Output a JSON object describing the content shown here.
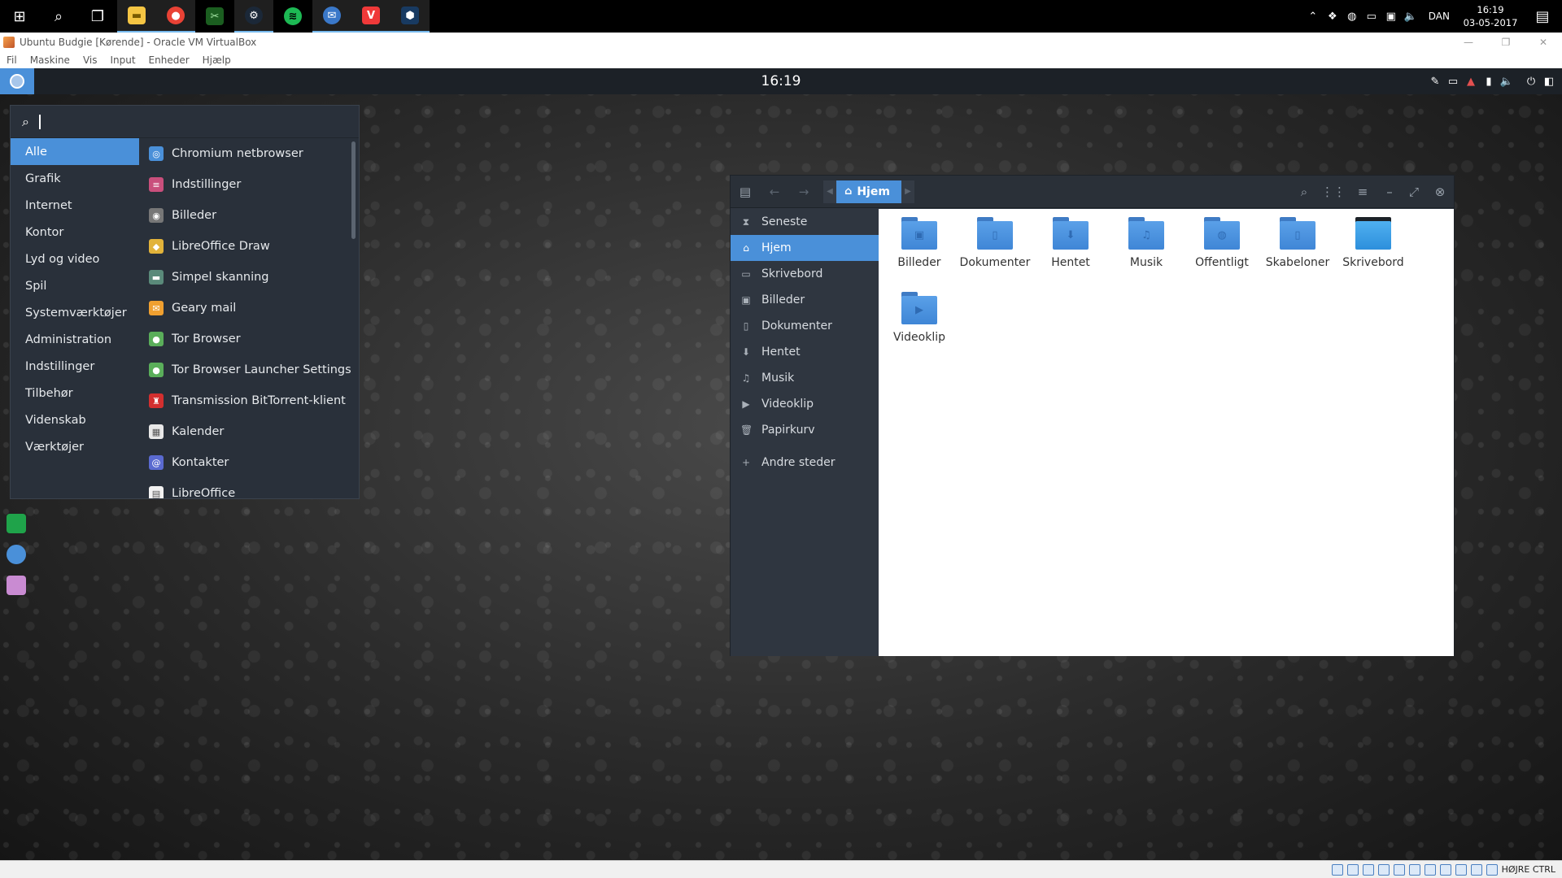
{
  "taskbar": {
    "icons": [
      "windows-start-icon",
      "search-icon",
      "task-view-icon",
      "file-explorer-icon",
      "chrome-icon",
      "app-icon",
      "steam-icon",
      "spotify-icon",
      "thunderbird-icon",
      "vivaldi-icon",
      "virtualbox-icon"
    ],
    "language": "DAN",
    "time": "16:19",
    "date": "03-05-2017"
  },
  "vbox": {
    "title": "Ubuntu Budgie [Kørende] - Oracle VM VirtualBox",
    "menu": [
      "Fil",
      "Maskine",
      "Vis",
      "Input",
      "Enheder",
      "Hjælp"
    ],
    "host_key": "HØJRE CTRL"
  },
  "panel": {
    "clock": "16:19"
  },
  "app_menu": {
    "search_placeholder": "",
    "categories": [
      "Alle",
      "Grafik",
      "Internet",
      "Kontor",
      "Lyd og video",
      "Spil",
      "Systemværktøjer",
      "Administration",
      "Indstillinger",
      "Tilbehør",
      "Videnskab",
      "Værktøjer"
    ],
    "selected_category": "Alle",
    "apps": [
      {
        "label": "Chromium netbrowser",
        "color": "#4a90d9",
        "glyph": "◎"
      },
      {
        "label": "Indstillinger",
        "color": "#c94f7c",
        "glyph": "≡"
      },
      {
        "label": "Billeder",
        "color": "#777777",
        "glyph": "◉"
      },
      {
        "label": "LibreOffice Draw",
        "color": "#e2b33a",
        "glyph": "◆"
      },
      {
        "label": "Simpel skanning",
        "color": "#5a8a7a",
        "glyph": "▬"
      },
      {
        "label": "Geary mail",
        "color": "#f0a030",
        "glyph": "✉"
      },
      {
        "label": "Tor Browser",
        "color": "#5aae5a",
        "glyph": "●"
      },
      {
        "label": "Tor Browser Launcher Settings",
        "color": "#5aae5a",
        "glyph": "●"
      },
      {
        "label": "Transmission BitTorrent-klient",
        "color": "#d32f2f",
        "glyph": "♜"
      },
      {
        "label": "Kalender",
        "color": "#e8e8e8",
        "glyph": "▦"
      },
      {
        "label": "Kontakter",
        "color": "#5a6ad0",
        "glyph": "@"
      },
      {
        "label": "LibreOffice",
        "color": "#f2f2f2",
        "glyph": "▤"
      }
    ]
  },
  "files": {
    "path": "Hjem",
    "sidebar": [
      {
        "label": "Seneste",
        "icon": "⧗"
      },
      {
        "label": "Hjem",
        "icon": "⌂"
      },
      {
        "label": "Skrivebord",
        "icon": "▭"
      },
      {
        "label": "Billeder",
        "icon": "▣"
      },
      {
        "label": "Dokumenter",
        "icon": "▯"
      },
      {
        "label": "Hentet",
        "icon": "⬇"
      },
      {
        "label": "Musik",
        "icon": "♫"
      },
      {
        "label": "Videoklip",
        "icon": "▶"
      },
      {
        "label": "Papirkurv",
        "icon": "🗑"
      },
      {
        "label": "Andre steder",
        "icon": "+"
      }
    ],
    "selected_sidebar": "Hjem",
    "items": [
      {
        "label": "Billeder",
        "glyph": "▣"
      },
      {
        "label": "Dokumenter",
        "glyph": "▯"
      },
      {
        "label": "Hentet",
        "glyph": "⬇"
      },
      {
        "label": "Musik",
        "glyph": "♫"
      },
      {
        "label": "Offentligt",
        "glyph": "◍"
      },
      {
        "label": "Skabeloner",
        "glyph": "▯"
      },
      {
        "label": "Skrivebord",
        "glyph": ""
      },
      {
        "label": "Videoklip",
        "glyph": "▶"
      }
    ]
  }
}
